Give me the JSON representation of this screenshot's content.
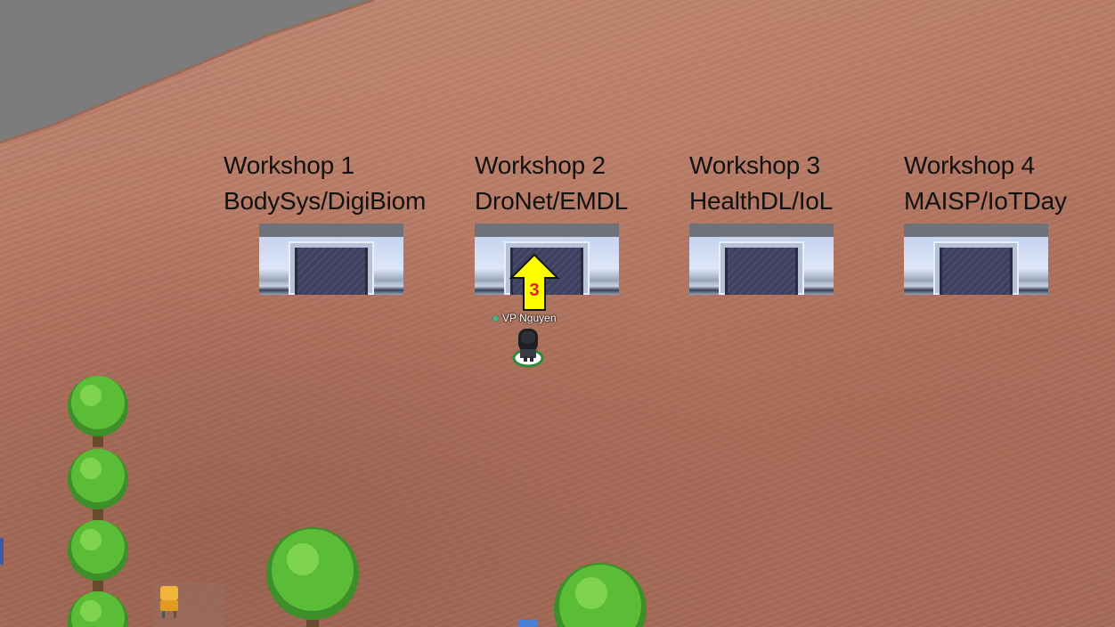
{
  "workshops": [
    {
      "title": "Workshop 1",
      "subtitle": "BodySys/DigiBiom"
    },
    {
      "title": "Workshop 2",
      "subtitle": "DroNet/EMDL"
    },
    {
      "title": "Workshop 3",
      "subtitle": "HealthDL/IoL"
    },
    {
      "title": "Workshop 4",
      "subtitle": "MAISP/IoTDay"
    }
  ],
  "arrow": {
    "label": "3",
    "color": "#ffff00",
    "label_color": "#e3201b"
  },
  "player": {
    "name": "VP Nguyen",
    "status": "online",
    "status_color": "#4caf7d"
  },
  "colors": {
    "ground": "#b97a63",
    "void": "#7a7a7a",
    "tree_green": "#4fb830"
  }
}
